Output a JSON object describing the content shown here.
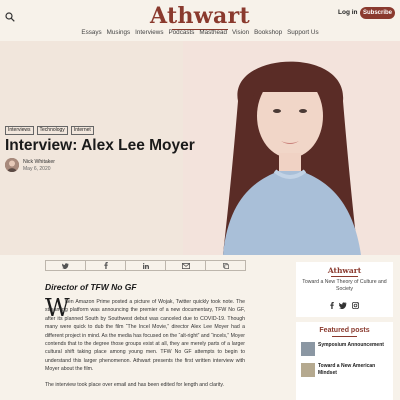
{
  "header": {
    "logo": "Athwart",
    "login_label": "Log in",
    "subscribe_label": "Subscribe",
    "search_icon": "search-icon"
  },
  "nav": [
    "Essays",
    "Musings",
    "Interviews",
    "Podcasts",
    "Masthead",
    "Vision",
    "Bookshop",
    "Support Us"
  ],
  "article": {
    "tags": [
      "Interviews",
      "Technology",
      "Internet"
    ],
    "title": "Interview: Alex Lee Moyer",
    "author_name": "Nick Whitaker",
    "date": "May 6, 2020",
    "director_heading": "Director of TFW No GF",
    "dropcap": "W",
    "paragraph1": "hen Amazon Prime posted a picture of Wojak, Twitter quickly took note. The streaming platform was announcing the premier of a new documentary, TFW No GF, after its planned South by Southwest debut was canceled due to COVID-19. Though many were quick to dub the film “The Incel Movie,” director Alex Lee Moyer had a different project in mind. As the media has focused on the “alt-right” and “incels,” Moyer contends that to the degree those groups exist at all, they are merely parts of a larger cultural shift taking place among young men. TFW No GF attempts to begin to understand this larger phenomenon. Athwart presents the first written interview with Moyer about the film.",
    "paragraph2": "The interview took place over email and has been edited for length and clarity."
  },
  "share_icons": [
    "twitter-icon",
    "facebook-icon",
    "linkedin-icon",
    "email-icon",
    "copy-link-icon"
  ],
  "sidebar": {
    "title": "Athwart",
    "tagline": "Toward a New Theory of Culture and Society",
    "social_icons": [
      "facebook-icon",
      "twitter-icon",
      "instagram-icon"
    ]
  },
  "featured": {
    "title": "Featured posts",
    "items": [
      "Symposium Announcement",
      "Toward a New American Mindset"
    ]
  },
  "colors": {
    "brand": "#8a3a2e",
    "background": "#f7f2ea"
  }
}
